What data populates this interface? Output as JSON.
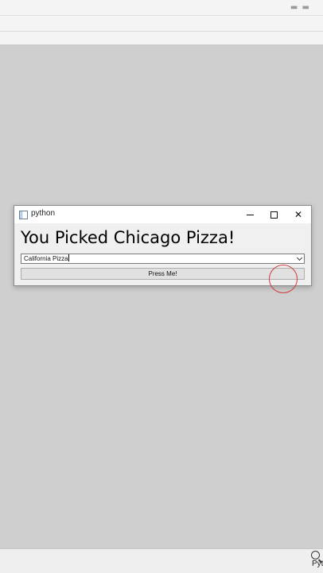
{
  "window": {
    "title": "python",
    "icon": "python-window-icon",
    "controls": {
      "minimize": "minimize-icon",
      "maximize": "maximize-icon",
      "close_glyph": "✕"
    }
  },
  "main": {
    "heading": "You Picked Chicago Pizza!",
    "combo": {
      "value": "California Pizza",
      "icon": "chevron-down-icon"
    },
    "button_label": "Press Me!"
  },
  "taskbar": {
    "label": "Pyt",
    "icon": "search-icon"
  },
  "colors": {
    "desktop": "#cfcfcf",
    "window_bg": "#f0f0f0",
    "click_indicator": "#d23c3c"
  }
}
